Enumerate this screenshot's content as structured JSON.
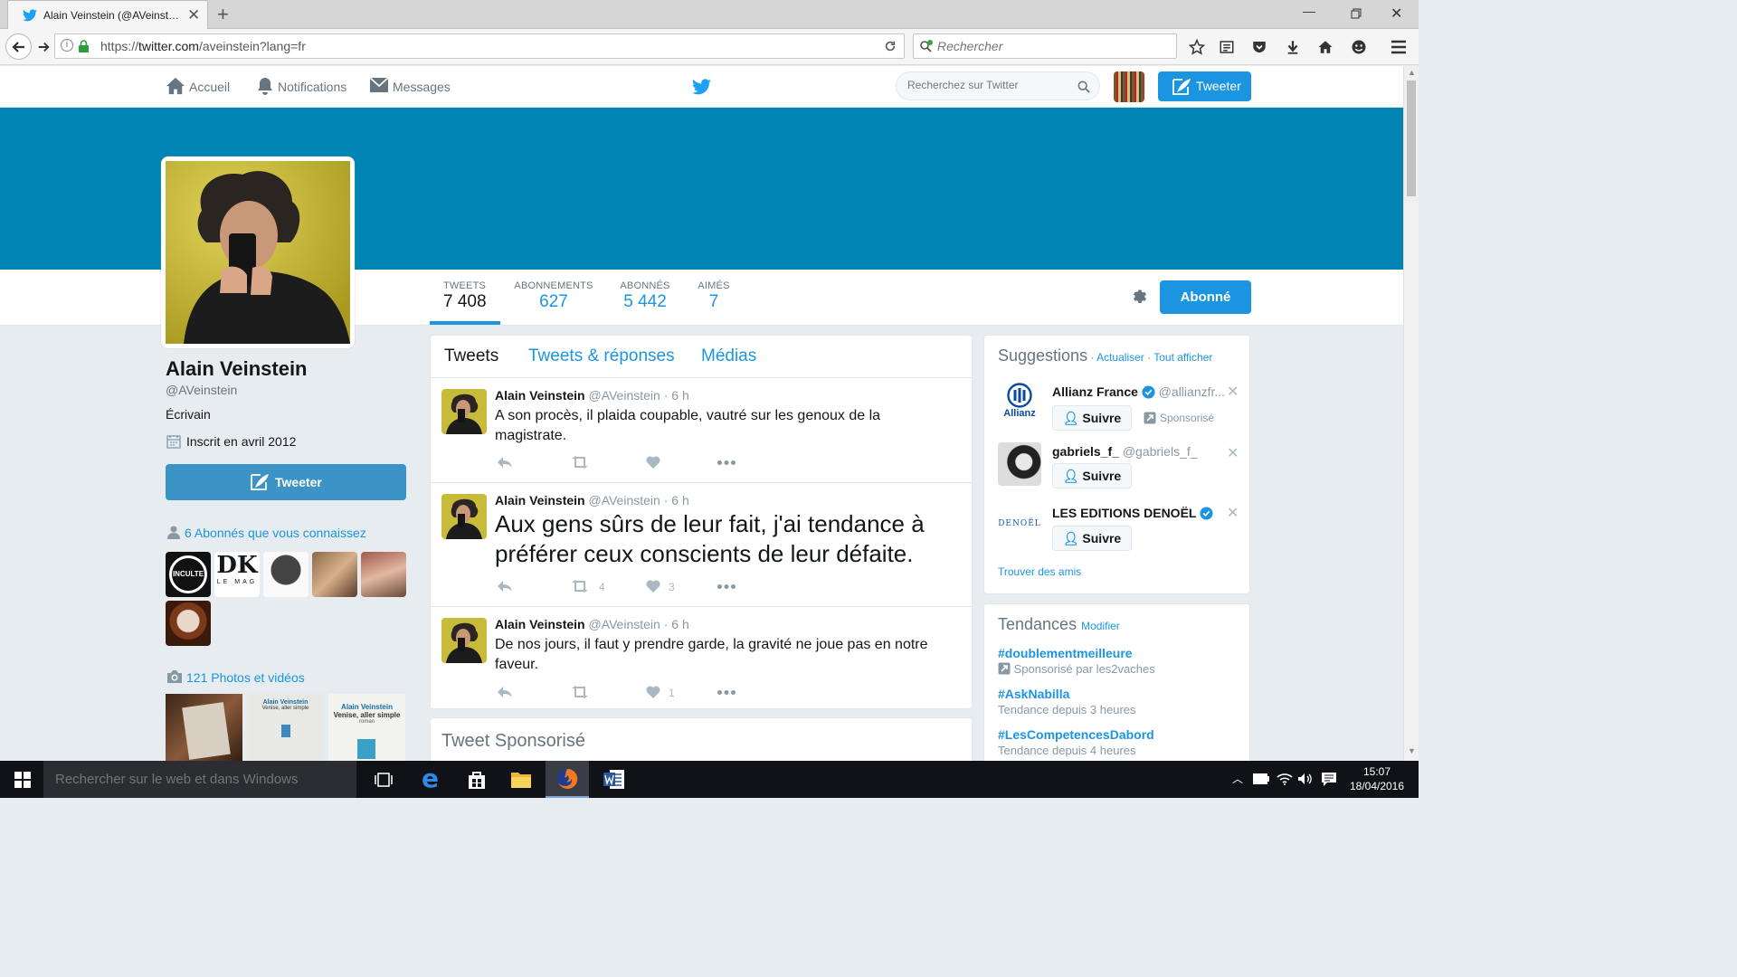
{
  "browser": {
    "tab_title": "Alain Veinstein (@AVeinst…",
    "url_prefix": "https://",
    "url_domain": "twitter.com",
    "url_path": "/aveinstein?lang=fr",
    "search_placeholder": "Rechercher"
  },
  "nav": {
    "home": "Accueil",
    "notifications": "Notifications",
    "messages": "Messages",
    "search_placeholder": "Recherchez sur Twitter",
    "tweet_button": "Tweeter"
  },
  "stats": [
    {
      "label": "TWEETS",
      "value": "7 408"
    },
    {
      "label": "ABONNEMENTS",
      "value": "627"
    },
    {
      "label": "ABONNÉS",
      "value": "5 442"
    },
    {
      "label": "AIMÉS",
      "value": "7"
    }
  ],
  "follow_state_button": "Abonné",
  "profile": {
    "name": "Alain Veinstein",
    "handle": "@AVeinstein",
    "bio": "Écrivain",
    "joined": "Inscrit en avril 2012",
    "tweet_button": "Tweeter",
    "known_followers": "6 Abonnés que vous connaissez",
    "photos": "121 Photos et vidéos",
    "follower_thumbs": {
      "inculte": "INCULTE",
      "dk": "DK",
      "dk_sub": "LE MAG"
    },
    "book_cover": {
      "author": "Alain Veinstein",
      "title": "Venise, aller simple",
      "genre": "roman"
    }
  },
  "timeline_tabs": [
    "Tweets",
    "Tweets & réponses",
    "Médias"
  ],
  "tweets": [
    {
      "name": "Alain Veinstein",
      "handle": "@AVeinstein",
      "time": "6 h",
      "text": "A son procès, il plaida coupable, vautré sur les genoux de la magistrate.",
      "retweets": "",
      "likes": ""
    },
    {
      "name": "Alain Veinstein",
      "handle": "@AVeinstein",
      "time": "6 h",
      "text": "Aux gens sûrs de leur fait, j'ai tendance à préférer ceux conscients de leur défaite.",
      "retweets": "4",
      "likes": "3"
    },
    {
      "name": "Alain Veinstein",
      "handle": "@AVeinstein",
      "time": "6 h",
      "text": "De nos jours, il faut y prendre garde, la gravité ne joue pas en notre faveur.",
      "retweets": "",
      "likes": "1"
    }
  ],
  "sponsored_title": "Tweet Sponsorisé",
  "suggestions": {
    "title": "Suggestions",
    "refresh": "Actualiser",
    "view_all": "Tout afficher",
    "follow_label": "Suivre",
    "find_friends": "Trouver des amis",
    "items": [
      {
        "name": "Allianz France",
        "handle": "@allianzfr...",
        "logo_text": "Allianz",
        "sponsored": "Sponsorisé"
      },
      {
        "name": "gabriels_f_",
        "handle": "@gabriels_f_"
      },
      {
        "name": "LES EDITIONS DENOËL",
        "handle": "",
        "logo_text": "DENOËL"
      }
    ]
  },
  "trends": {
    "title": "Tendances",
    "modify": "Modifier",
    "items": [
      {
        "tag": "#doublementmeilleure",
        "sub": "Sponsorisé par les2vaches"
      },
      {
        "tag": "#AskNabilla",
        "sub": "Tendance depuis 3 heures"
      },
      {
        "tag": "#LesCompetencesDabord",
        "sub": "Tendance depuis 4 heures"
      }
    ]
  },
  "taskbar": {
    "search_placeholder": "Rechercher sur le web et dans Windows",
    "time": "15:07",
    "date": "18/04/2016"
  },
  "colors": {
    "twitter_blue": "#1b95e0",
    "banner": "#0084b4",
    "taskbar": "#101218"
  }
}
